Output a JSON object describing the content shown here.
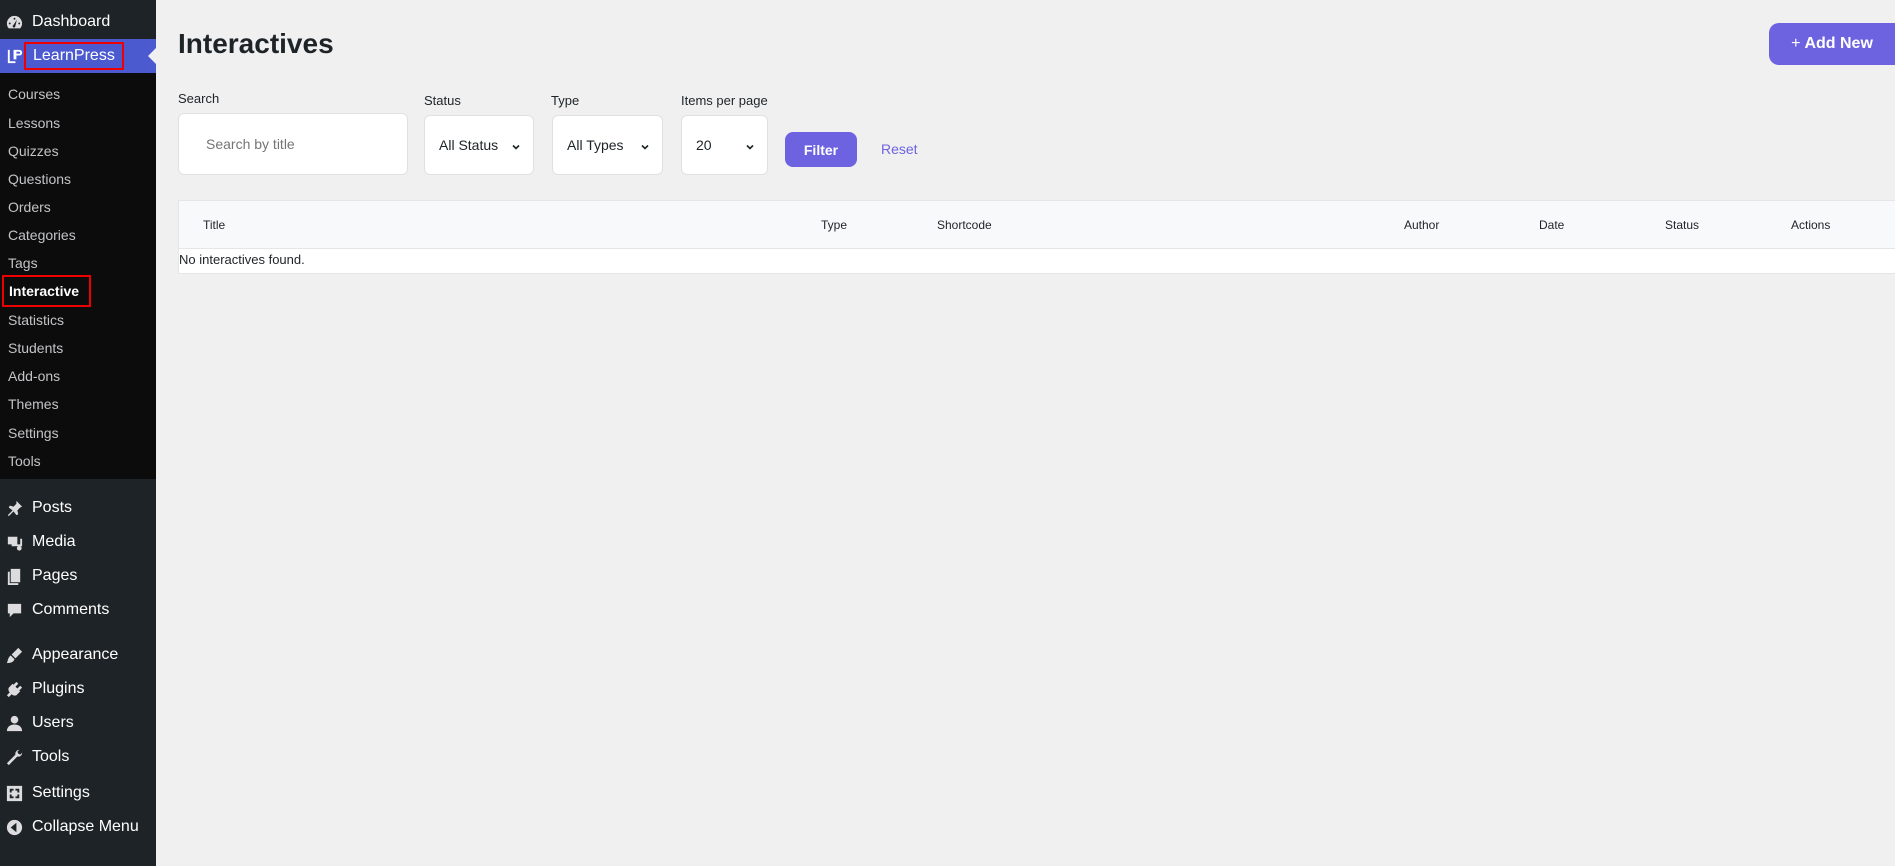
{
  "sidebar": {
    "top_items": [
      {
        "label": "Dashboard",
        "icon": "dashboard-icon"
      }
    ],
    "active": {
      "label": "LearnPress",
      "icon": "learnpress-icon"
    },
    "submenu": [
      {
        "label": "Courses"
      },
      {
        "label": "Lessons"
      },
      {
        "label": "Quizzes"
      },
      {
        "label": "Questions"
      },
      {
        "label": "Orders"
      },
      {
        "label": "Categories"
      },
      {
        "label": "Tags"
      },
      {
        "label": "Interactive",
        "current": true
      },
      {
        "label": "Statistics"
      },
      {
        "label": "Students"
      },
      {
        "label": "Add-ons"
      },
      {
        "label": "Themes"
      },
      {
        "label": "Settings"
      },
      {
        "label": "Tools"
      }
    ],
    "bottom_items": [
      {
        "label": "Posts",
        "icon": "pin-icon"
      },
      {
        "label": "Media",
        "icon": "media-icon"
      },
      {
        "label": "Pages",
        "icon": "pages-icon"
      },
      {
        "label": "Comments",
        "icon": "comment-icon"
      },
      {
        "label": "Appearance",
        "icon": "brush-icon"
      },
      {
        "label": "Plugins",
        "icon": "plugin-icon"
      },
      {
        "label": "Users",
        "icon": "user-icon"
      },
      {
        "label": "Tools",
        "icon": "wrench-icon"
      },
      {
        "label": "Settings",
        "icon": "settings-icon"
      },
      {
        "label": "Collapse Menu",
        "icon": "collapse-icon"
      }
    ]
  },
  "header": {
    "title": "Interactives",
    "add_new_label": "Add New",
    "add_new_icon": "+"
  },
  "filters": {
    "search_label": "Search",
    "search_placeholder": "Search by title",
    "status_label": "Status",
    "status_value": "All Status",
    "type_label": "Type",
    "type_value": "All Types",
    "per_page_label": "Items per page",
    "per_page_value": "20",
    "filter_label": "Filter",
    "reset_label": "Reset"
  },
  "table": {
    "columns": [
      "Title",
      "Type",
      "Shortcode",
      "Author",
      "Date",
      "Status",
      "Actions"
    ],
    "empty_message": "No interactives found."
  },
  "colors": {
    "accent": "#6d63e0",
    "sidebar_bg": "#1d2327",
    "submenu_bg": "#0c0c0c",
    "active_bg": "#4c5ad0",
    "highlight_border": "#ee0000"
  }
}
